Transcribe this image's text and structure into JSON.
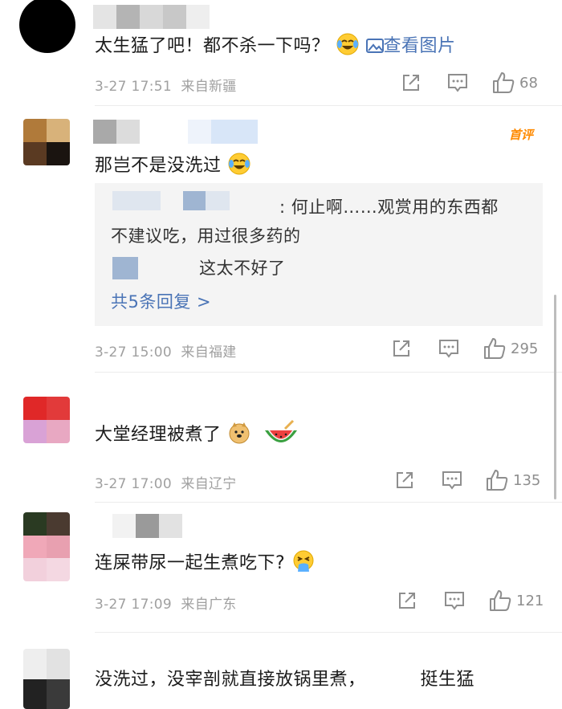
{
  "comments": [
    {
      "text": "太生猛了吧！都不杀一下吗？",
      "view_image": "查看图片",
      "time": "3-27 17:51",
      "source": "来自新疆",
      "likes": "68"
    },
    {
      "text": "那岂不是没洗过",
      "badge": "首评",
      "replies": [
        ": 何止啊……观赏用的东西都",
        "不建议吃，用过很多药的",
        "这太不好了"
      ],
      "more_replies": "共5条回复 >",
      "time": "3-27 15:00",
      "source": "来自福建",
      "likes": "295"
    },
    {
      "text": "大堂经理被煮了",
      "time": "3-27 17:00",
      "source": "来自辽宁",
      "likes": "135"
    },
    {
      "text": "连屎带尿一起生煮吃下?",
      "time": "3-27 17:09",
      "source": "来自广东",
      "likes": "121"
    },
    {
      "text": "没洗过，没宰剖就直接放锅里煮，",
      "text_tail": "挺生猛"
    }
  ],
  "colors": {
    "link": "#4a74b6",
    "meta": "#a0a0a0",
    "badge": "#ff8a00",
    "reply_bg": "#f4f4f4"
  },
  "icons": [
    "share-icon",
    "comment-icon",
    "like-icon",
    "laugh-cry-emoji",
    "doge-emoji",
    "watermelon-emoji",
    "vomit-emoji",
    "image-icon"
  ]
}
